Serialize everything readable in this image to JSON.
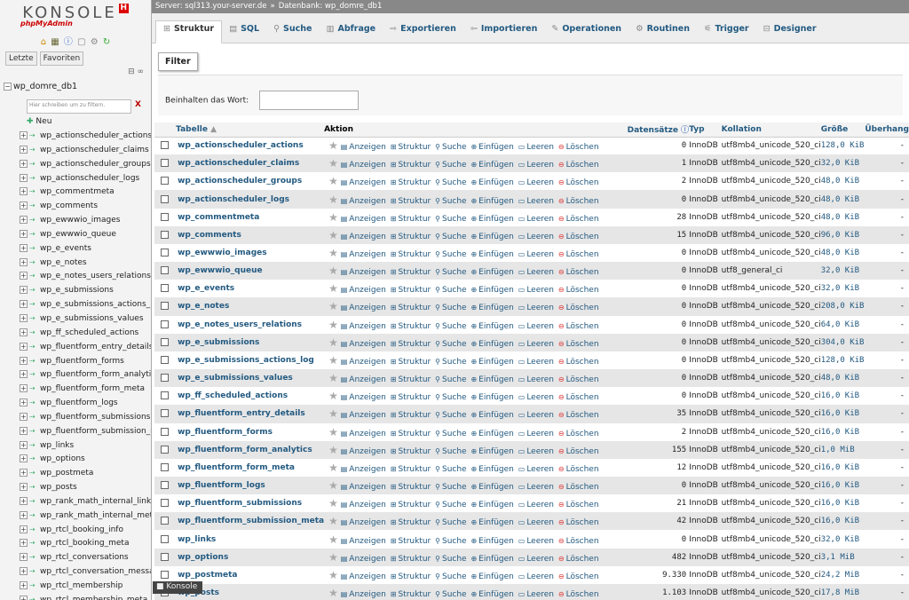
{
  "sidebar": {
    "logo_title": "KONSOLE",
    "logo_badge": "H",
    "logo_sub": "phpMyAdmin",
    "quick_icons": [
      "home-icon",
      "database-icon",
      "info-icon",
      "docs-icon",
      "settings-icon",
      "reload-icon"
    ],
    "recent_label": "Letzte",
    "favorites_label": "Favoriten",
    "db_name": "wp_domre_db1",
    "filter_placeholder": "Hier schreiben um zu filtern.",
    "filter_clear": "X",
    "new_label": "Neu",
    "tables": [
      "wp_actionscheduler_actions",
      "wp_actionscheduler_claims",
      "wp_actionscheduler_groups",
      "wp_actionscheduler_logs",
      "wp_commentmeta",
      "wp_comments",
      "wp_ewwwio_images",
      "wp_ewwwio_queue",
      "wp_e_events",
      "wp_e_notes",
      "wp_e_notes_users_relations",
      "wp_e_submissions",
      "wp_e_submissions_actions_l",
      "wp_e_submissions_values",
      "wp_ff_scheduled_actions",
      "wp_fluentform_entry_details",
      "wp_fluentform_forms",
      "wp_fluentform_form_analytics",
      "wp_fluentform_form_meta",
      "wp_fluentform_logs",
      "wp_fluentform_submissions",
      "wp_fluentform_submission_m",
      "wp_links",
      "wp_options",
      "wp_postmeta",
      "wp_posts",
      "wp_rank_math_internal_links",
      "wp_rank_math_internal_meta",
      "wp_rtcl_booking_info",
      "wp_rtcl_booking_meta",
      "wp_rtcl_conversations",
      "wp_rtcl_conversation_messag",
      "wp_rtcl_membership",
      "wp_rtcl_membership_meta"
    ]
  },
  "breadcrumb": {
    "server": "Server: sql313.your-server.de",
    "sep": "»",
    "database": "Datenbank: wp_domre_db1"
  },
  "tabs": [
    {
      "label": "Struktur",
      "icon": "structure-icon",
      "glyph": "⊞"
    },
    {
      "label": "SQL",
      "icon": "sql-icon",
      "glyph": "▤"
    },
    {
      "label": "Suche",
      "icon": "search-icon",
      "glyph": "⚲"
    },
    {
      "label": "Abfrage",
      "icon": "query-icon",
      "glyph": "▥"
    },
    {
      "label": "Exportieren",
      "icon": "export-icon",
      "glyph": "⇨"
    },
    {
      "label": "Importieren",
      "icon": "import-icon",
      "glyph": "⇦"
    },
    {
      "label": "Operationen",
      "icon": "operations-icon",
      "glyph": "✎"
    },
    {
      "label": "Routinen",
      "icon": "routines-icon",
      "glyph": "⚙"
    },
    {
      "label": "Trigger",
      "icon": "trigger-icon",
      "glyph": "⚟"
    },
    {
      "label": "Designer",
      "icon": "designer-icon",
      "glyph": "⊟"
    }
  ],
  "filter": {
    "legend": "Filter",
    "label": "Beinhalten das Wort:",
    "value": ""
  },
  "table": {
    "headers": {
      "tabelle": "Tabelle",
      "sort": "▲",
      "aktion": "Aktion",
      "datensaetze": "Datensätze",
      "typ": "Typ",
      "kollation": "Kollation",
      "groesse": "Größe",
      "ueberhang": "Überhang"
    },
    "actions": [
      "Anzeigen",
      "Struktur",
      "Suche",
      "Einfügen",
      "Leeren",
      "Löschen"
    ],
    "rows": [
      {
        "name": "wp_actionscheduler_actions",
        "rows": "0",
        "type": "InnoDB",
        "collation": "utf8mb4_unicode_520_ci",
        "size": "128,0 KiB",
        "overhead": "-"
      },
      {
        "name": "wp_actionscheduler_claims",
        "rows": "1",
        "type": "InnoDB",
        "collation": "utf8mb4_unicode_520_ci",
        "size": "32,0 KiB",
        "overhead": "-"
      },
      {
        "name": "wp_actionscheduler_groups",
        "rows": "2",
        "type": "InnoDB",
        "collation": "utf8mb4_unicode_520_ci",
        "size": "48,0 KiB",
        "overhead": "-"
      },
      {
        "name": "wp_actionscheduler_logs",
        "rows": "0",
        "type": "InnoDB",
        "collation": "utf8mb4_unicode_520_ci",
        "size": "48,0 KiB",
        "overhead": "-"
      },
      {
        "name": "wp_commentmeta",
        "rows": "28",
        "type": "InnoDB",
        "collation": "utf8mb4_unicode_520_ci",
        "size": "48,0 KiB",
        "overhead": "-"
      },
      {
        "name": "wp_comments",
        "rows": "15",
        "type": "InnoDB",
        "collation": "utf8mb4_unicode_520_ci",
        "size": "96,0 KiB",
        "overhead": "-"
      },
      {
        "name": "wp_ewwwio_images",
        "rows": "0",
        "type": "InnoDB",
        "collation": "utf8mb4_unicode_520_ci",
        "size": "48,0 KiB",
        "overhead": "-"
      },
      {
        "name": "wp_ewwwio_queue",
        "rows": "0",
        "type": "InnoDB",
        "collation": "utf8_general_ci",
        "size": "32,0 KiB",
        "overhead": "-"
      },
      {
        "name": "wp_e_events",
        "rows": "0",
        "type": "InnoDB",
        "collation": "utf8mb4_unicode_520_ci",
        "size": "32,0 KiB",
        "overhead": "-"
      },
      {
        "name": "wp_e_notes",
        "rows": "0",
        "type": "InnoDB",
        "collation": "utf8mb4_unicode_520_ci",
        "size": "208,0 KiB",
        "overhead": "-"
      },
      {
        "name": "wp_e_notes_users_relations",
        "rows": "0",
        "type": "InnoDB",
        "collation": "utf8mb4_unicode_520_ci",
        "size": "64,0 KiB",
        "overhead": "-"
      },
      {
        "name": "wp_e_submissions",
        "rows": "0",
        "type": "InnoDB",
        "collation": "utf8mb4_unicode_520_ci",
        "size": "304,0 KiB",
        "overhead": "-"
      },
      {
        "name": "wp_e_submissions_actions_log",
        "rows": "0",
        "type": "InnoDB",
        "collation": "utf8mb4_unicode_520_ci",
        "size": "128,0 KiB",
        "overhead": "-"
      },
      {
        "name": "wp_e_submissions_values",
        "rows": "0",
        "type": "InnoDB",
        "collation": "utf8mb4_unicode_520_ci",
        "size": "48,0 KiB",
        "overhead": "-"
      },
      {
        "name": "wp_ff_scheduled_actions",
        "rows": "0",
        "type": "InnoDB",
        "collation": "utf8mb4_unicode_520_ci",
        "size": "16,0 KiB",
        "overhead": "-"
      },
      {
        "name": "wp_fluentform_entry_details",
        "rows": "35",
        "type": "InnoDB",
        "collation": "utf8mb4_unicode_520_ci",
        "size": "16,0 KiB",
        "overhead": "-"
      },
      {
        "name": "wp_fluentform_forms",
        "rows": "2",
        "type": "InnoDB",
        "collation": "utf8mb4_unicode_520_ci",
        "size": "16,0 KiB",
        "overhead": "-"
      },
      {
        "name": "wp_fluentform_form_analytics",
        "rows": "155",
        "type": "InnoDB",
        "collation": "utf8mb4_unicode_520_ci",
        "size": "1,0 MiB",
        "overhead": "-"
      },
      {
        "name": "wp_fluentform_form_meta",
        "rows": "12",
        "type": "InnoDB",
        "collation": "utf8mb4_unicode_520_ci",
        "size": "16,0 KiB",
        "overhead": "-"
      },
      {
        "name": "wp_fluentform_logs",
        "rows": "0",
        "type": "InnoDB",
        "collation": "utf8mb4_unicode_520_ci",
        "size": "16,0 KiB",
        "overhead": "-"
      },
      {
        "name": "wp_fluentform_submissions",
        "rows": "21",
        "type": "InnoDB",
        "collation": "utf8mb4_unicode_520_ci",
        "size": "16,0 KiB",
        "overhead": "-"
      },
      {
        "name": "wp_fluentform_submission_meta",
        "rows": "42",
        "type": "InnoDB",
        "collation": "utf8mb4_unicode_520_ci",
        "size": "16,0 KiB",
        "overhead": "-"
      },
      {
        "name": "wp_links",
        "rows": "0",
        "type": "InnoDB",
        "collation": "utf8mb4_unicode_520_ci",
        "size": "32,0 KiB",
        "overhead": "-"
      },
      {
        "name": "wp_options",
        "rows": "482",
        "type": "InnoDB",
        "collation": "utf8mb4_unicode_520_ci",
        "size": "3,1 MiB",
        "overhead": "-"
      },
      {
        "name": "wp_postmeta",
        "rows": "9.330",
        "type": "InnoDB",
        "collation": "utf8mb4_unicode_520_ci",
        "size": "24,2 MiB",
        "overhead": "-"
      },
      {
        "name": "wp_posts",
        "rows": "1.103",
        "type": "InnoDB",
        "collation": "utf8mb4_unicode_520_ci",
        "size": "17,8 MiB",
        "overhead": "-"
      }
    ]
  },
  "console": {
    "label": "Konsole"
  }
}
